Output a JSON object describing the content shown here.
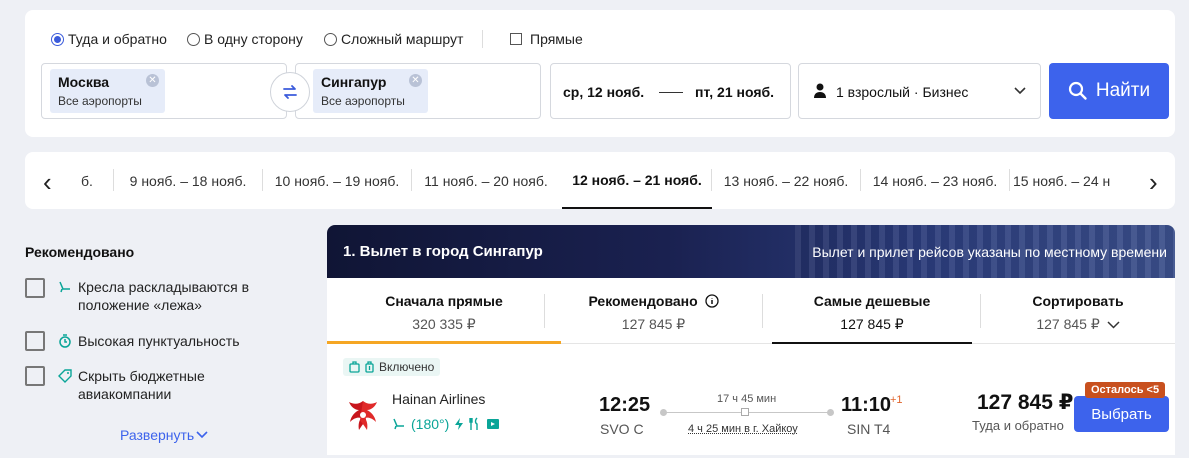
{
  "search": {
    "trip_types": [
      {
        "label": "Туда и обратно",
        "selected": true
      },
      {
        "label": "В одну сторону",
        "selected": false
      },
      {
        "label": "Сложный маршрут",
        "selected": false
      }
    ],
    "direct_label": "Прямые",
    "from": {
      "city": "Москва",
      "airports": "Все аэропорты"
    },
    "to": {
      "city": "Сингапур",
      "airports": "Все аэропорты"
    },
    "date_from": "ср, 12 нояб.",
    "date_to": "пт, 21 нояб.",
    "passengers": "1 взрослый · Бизнес",
    "search_button": "Найти",
    "accent_color": "#3d63ec"
  },
  "date_strip": {
    "items": [
      "б.",
      "9 нояб. – 18 нояб.",
      "10 нояб. – 19 нояб.",
      "11 нояб. – 20 нояб.",
      "12 нояб. – 21 нояб.",
      "13 нояб. – 22 нояб.",
      "14 нояб. – 23 нояб.",
      "15 нояб. – 24 н"
    ],
    "active_index": 4
  },
  "filters": {
    "title": "Рекомендовано",
    "items": [
      {
        "label": "Кресла раскладываются в положение «лежа»",
        "icon": "seat-icon"
      },
      {
        "label": "Высокая пунктуальность",
        "icon": "clock-icon"
      },
      {
        "label": "Скрыть бюджетные авиакомпании",
        "icon": "tag-icon"
      }
    ],
    "expand": "Развернуть"
  },
  "results": {
    "banner_title": "1. Вылет в город Сингапур",
    "banner_note": "Вылет и прилет рейсов указаны по местному времени",
    "tabs": [
      {
        "title": "Сначала прямые",
        "price": "320 335 ₽"
      },
      {
        "title": "Рекомендовано",
        "price": "127 845 ₽"
      },
      {
        "title": "Самые дешевые",
        "price": "127 845 ₽"
      },
      {
        "title": "Сортировать",
        "price": "127 845 ₽"
      }
    ],
    "flight": {
      "included": "Включено",
      "airline": "Hainan Airlines",
      "seat_angle": "(180°)",
      "depart_time": "12:25",
      "depart_airport": "SVO C",
      "duration": "17 ч 45 мин",
      "layover": "4 ч 25 мин в г. Хайкоу",
      "arrive_time": "11:10",
      "day_offset": "+1",
      "arrive_airport": "SIN T4",
      "price": "127 845 ₽",
      "price_note": "Туда и обратно",
      "seats_left": "Осталось <5",
      "select_button": "Выбрать"
    }
  }
}
